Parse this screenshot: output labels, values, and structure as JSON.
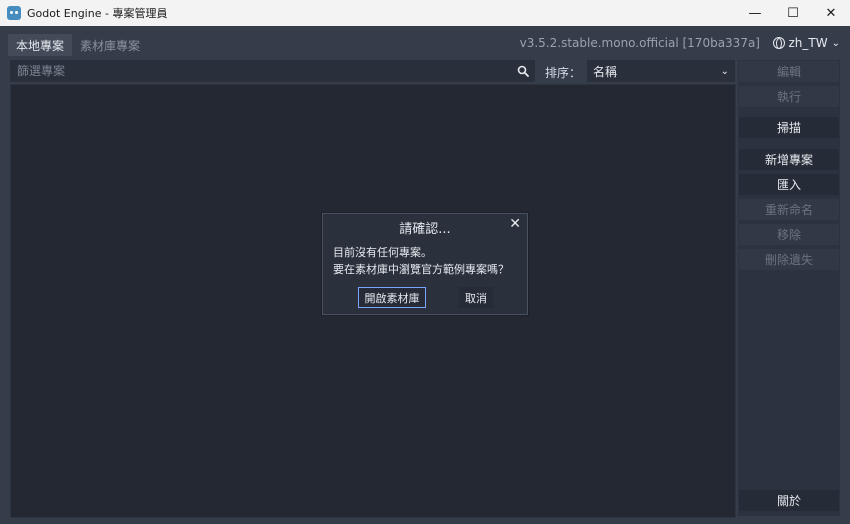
{
  "window": {
    "title": "Godot Engine - 專案管理員",
    "minimize_glyph": "—",
    "maximize_glyph": "☐",
    "close_glyph": "✕"
  },
  "tabs": [
    {
      "label": "本地專案",
      "active": true
    },
    {
      "label": "素材庫專案",
      "active": false
    }
  ],
  "version_label": "v3.5.2.stable.mono.official [170ba337a]",
  "language": {
    "label": "zh_TW",
    "icon": "globe-icon"
  },
  "filter": {
    "placeholder": "篩選專案",
    "value": ""
  },
  "sort": {
    "label": "排序：",
    "selected": "名稱"
  },
  "sidebar": {
    "buttons": [
      {
        "label": "編輯",
        "enabled": false
      },
      {
        "label": "執行",
        "enabled": false
      },
      {
        "label": "掃描",
        "enabled": true
      },
      {
        "label": "新增專案",
        "enabled": true
      },
      {
        "label": "匯入",
        "enabled": true
      },
      {
        "label": "重新命名",
        "enabled": false
      },
      {
        "label": "移除",
        "enabled": false
      },
      {
        "label": "刪除遺失",
        "enabled": false
      }
    ],
    "about_label": "關於"
  },
  "dialog": {
    "title": "請確認...",
    "message_line1": "目前沒有任何專案。",
    "message_line2": "要在素材庫中瀏覽官方範例專案嗎？",
    "primary_label": "開啟素材庫",
    "secondary_label": "取消"
  },
  "colors": {
    "background": "#363d4a",
    "panel": "#232833",
    "accent": "#7aa6ff"
  }
}
